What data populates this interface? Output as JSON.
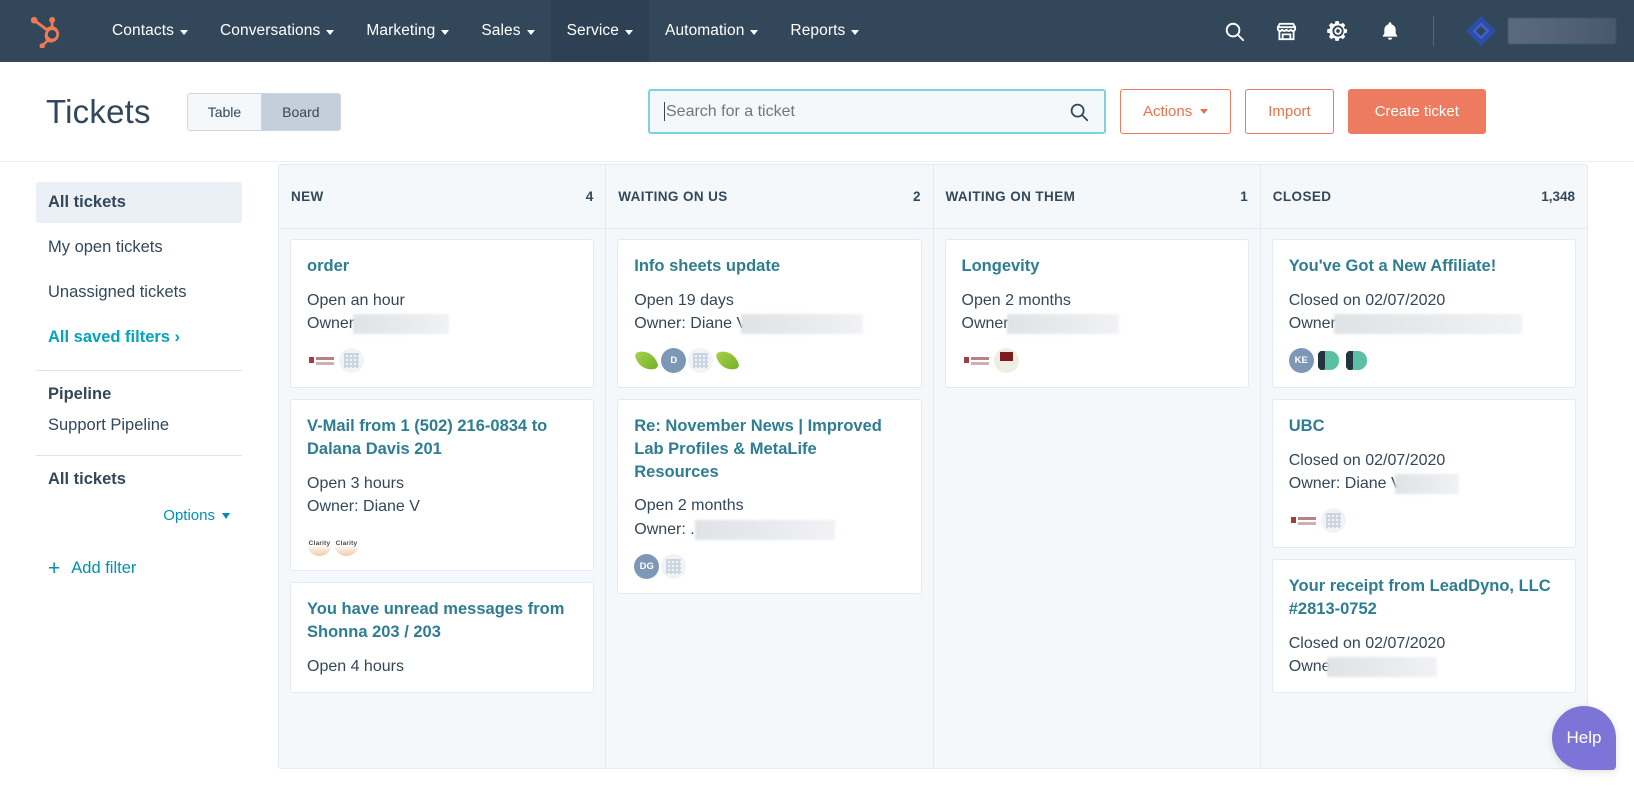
{
  "topnav": {
    "logo_icon": "hubspot-sprocket-icon",
    "items": [
      {
        "label": "Contacts",
        "has_caret": true,
        "active": false
      },
      {
        "label": "Conversations",
        "has_caret": true,
        "active": false
      },
      {
        "label": "Marketing",
        "has_caret": true,
        "active": false
      },
      {
        "label": "Sales",
        "has_caret": true,
        "active": false
      },
      {
        "label": "Service",
        "has_caret": true,
        "active": true
      },
      {
        "label": "Automation",
        "has_caret": true,
        "active": false
      },
      {
        "label": "Reports",
        "has_caret": true,
        "active": false
      }
    ],
    "icons": [
      "search-icon",
      "marketplace-icon",
      "settings-gear-icon",
      "notifications-bell-icon"
    ],
    "account_logo": "blue-diamond-logo",
    "account_name_redacted": true
  },
  "header": {
    "title": "Tickets",
    "view_toggle": {
      "options": [
        "Table",
        "Board"
      ],
      "selected": "Board"
    },
    "search": {
      "placeholder": "Search for a ticket",
      "value": ""
    },
    "actions_label": "Actions",
    "import_label": "Import",
    "create_label": "Create ticket"
  },
  "sidebar": {
    "filters": [
      {
        "label": "All tickets",
        "active": true
      },
      {
        "label": "My open tickets",
        "active": false
      },
      {
        "label": "Unassigned tickets",
        "active": false
      }
    ],
    "all_saved_filters_label": "All saved filters ›",
    "pipeline_heading": "Pipeline",
    "pipeline_value": "Support Pipeline",
    "list_heading": "All tickets",
    "options_label": "Options",
    "add_filter_label": "Add filter"
  },
  "board": {
    "columns": [
      {
        "name": "NEW",
        "count": "4",
        "cards": [
          {
            "title": "order",
            "status": "Open an hour",
            "owner_label": "Owner:",
            "owner_value": "",
            "owner_redacted": true,
            "redact_width": 96,
            "avatars": [
              "align-life-logo-icon",
              "grid-avatar-icon"
            ]
          },
          {
            "title": "V-Mail from 1 (502) 216-0834 to Dalana Davis 201",
            "status": "Open 3 hours",
            "owner_label": "Owner: Diane V",
            "owner_value": "Diane V",
            "owner_redacted": false,
            "redact_width": 0,
            "avatars": [
              "clarity-logo-icon",
              "clarity-logo-icon"
            ]
          },
          {
            "title": "You have unread messages from Shonna 203 / 203",
            "status": "Open 4 hours",
            "owner_label": "",
            "owner_value": "",
            "owner_redacted": false,
            "redact_width": 0,
            "avatars": []
          }
        ]
      },
      {
        "name": "WAITING ON US",
        "count": "2",
        "cards": [
          {
            "title": "Info sheets update",
            "status": "Open 19 days",
            "owner_label": "Owner: Diane V",
            "owner_value": "Diane V",
            "owner_redacted": true,
            "redact_width": 122,
            "avatars": [
              "leaf-logo-icon",
              "initials-d-avatar",
              "grid-avatar-icon",
              "leaf-logo-icon"
            ]
          },
          {
            "title": "Re: November News | Improved Lab Profiles & MetaLife Resources",
            "status": "Open 2 months",
            "owner_label": "Owner: .",
            "owner_value": "",
            "owner_redacted": true,
            "redact_width": 140,
            "avatars": [
              "initials-dg-avatar",
              "grid-avatar-icon"
            ]
          }
        ]
      },
      {
        "name": "WAITING ON THEM",
        "count": "1",
        "cards": [
          {
            "title": "Longevity",
            "status": "Open 2 months",
            "owner_label": "Owner:",
            "owner_value": "",
            "owner_redacted": true,
            "redact_width": 112,
            "avatars": [
              "align-life-logo-icon",
              "align-life-circle-icon"
            ]
          }
        ]
      },
      {
        "name": "CLOSED",
        "count": "1,348",
        "cards": [
          {
            "title": "You've Got a New Affiliate!",
            "status": "Closed on 02/07/2020",
            "owner_label": "Owner:",
            "owner_value": "",
            "owner_redacted": true,
            "redact_width": 188,
            "avatars": [
              "initials-ke-avatar",
              "leaddyno-logo-icon",
              "leaddyno-logo-icon"
            ]
          },
          {
            "title": "UBC",
            "status": "Closed on 02/07/2020",
            "owner_label": "Owner: Diane V",
            "owner_value": "Diane V",
            "owner_redacted": true,
            "redact_width": 64,
            "avatars": [
              "align-life-logo-icon",
              "grid-avatar-icon"
            ]
          },
          {
            "title": "Your receipt from LeadDyno, LLC #2813-0752",
            "status": "Closed on 02/07/2020",
            "owner_label": "Owner",
            "owner_value": "",
            "owner_redacted": true,
            "redact_width": 110,
            "avatars": []
          }
        ]
      }
    ]
  },
  "help": {
    "label": "Help"
  },
  "colors": {
    "nav_bg": "#33475b",
    "nav_active_bg": "#2e4054",
    "accent_orange": "#ed7b5f",
    "link_teal": "#2e7d92",
    "action_teal": "#0091ae",
    "board_bg": "#f5f8fa",
    "help_purple": "#7c74d6",
    "search_border": "#7fd1de"
  }
}
